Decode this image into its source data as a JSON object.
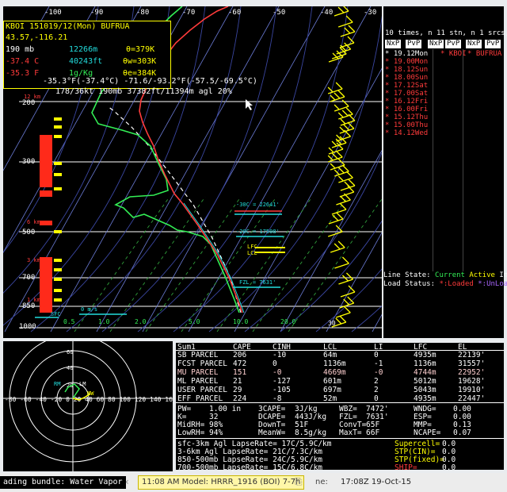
{
  "app": {
    "station_header": "KBOI 151019/12(Mon) BUFRUA",
    "latlon": "43.57,-116.21"
  },
  "readout": {
    "pressure": "190 mb",
    "height": "12266m",
    "theta": "θ=379K",
    "temp_c": "-37.4 C",
    "height_ft": "40243ft",
    "theta_w": "θw=303K",
    "dewpt_f": "-35.3 F",
    "mixing": "1g/Kg",
    "theta_e": "θe=384K",
    "line1": "-35.3°F(-37.4°C) -71.6/-93.2°F(-57.5/-69.5°C)",
    "line2": "178/36kt  190mb  37382ft/11394m agl  20%"
  },
  "temp_axis": [
    "-100",
    "-90",
    "-80",
    "-70",
    "-60",
    "-50",
    "-40",
    "-30"
  ],
  "pressure_axis": [
    "200",
    "300",
    "500",
    "700",
    "850",
    "1000"
  ],
  "km_labels": [
    "12 km",
    "6 km",
    "3 km",
    "1 km"
  ],
  "bottom_axis": [
    "0.5",
    "1.0",
    "2.0",
    "5.0",
    "10.0",
    "20.0",
    "30"
  ],
  "skewt_labels": {
    "minus30": "-30C = 22641'",
    "minus20": "-20C = 17508'",
    "lfc": "LFC",
    "lcl": "LCL",
    "fzl": "FZL = 7631'",
    "sfc": "SFC",
    "scale": "0 m/s"
  },
  "profile_list": {
    "header": "10 times, n 11 stn, n 1 srcs, n 1",
    "buttons": [
      "NxP",
      "PvP",
      "NxP",
      "PvP",
      "NxP",
      "PvP"
    ],
    "times": [
      "19.12Mon",
      "19.00Mon",
      "18.12Sun",
      "18.00Sun",
      "17.12Sat",
      "17.00Sat",
      "16.12Fri",
      "16.00Fri",
      "15.12Thu",
      "15.00Thu",
      "14.12Wed"
    ],
    "station": "KBOI",
    "source": "BUFRUA",
    "line_state_label": "Line State:",
    "line_state_current": "Current",
    "line_state_active": "Active",
    "line_state_inactive": "InActiv",
    "load_status_label": "Load Status:",
    "load_status_loaded": "*:Loaded",
    "load_status_unloaded": "*:UnLoa"
  },
  "hodo": {
    "rings": [
      "20",
      "40",
      "60",
      "80"
    ],
    "axis": "-80 -60 -40 -20 0 20 40 60 80 100 120 140 160",
    "lm": "LM",
    "mw": "MW",
    "rm": "RM"
  },
  "parcel_table": {
    "headers": [
      "Sum1",
      "CAPE",
      "CINH",
      "LCL",
      "LI",
      "LFC",
      "EL"
    ],
    "rows": [
      [
        "SB PARCEL",
        "206",
        "-10",
        "64m",
        "0",
        "4935m",
        "22139'"
      ],
      [
        "FCST PARCEL",
        "472",
        "0",
        "1136m",
        "-1",
        "1136m",
        "31557'"
      ],
      [
        "MU PARCEL",
        "151",
        "-0",
        "4669m",
        "-0",
        "4744m",
        "22952'"
      ],
      [
        "ML PARCEL",
        "21",
        "-127",
        "601m",
        "2",
        "5012m",
        "19628'"
      ],
      [
        "USER PARCEL",
        "29",
        "-105",
        "697m",
        "2",
        "5043m",
        "19910'"
      ],
      [
        "EFF PARCEL",
        "224",
        "-8",
        "52m",
        "0",
        "4935m",
        "22447'"
      ]
    ],
    "indices": [
      [
        "PW=",
        "1.00 in",
        "3CAPE=",
        "3J/kg",
        "WBZ=",
        "7472'",
        "WNDG=",
        "0.00"
      ],
      [
        "K=",
        "32",
        "DCAPE=",
        "443J/kg",
        "FZL=",
        "7631'",
        "ESP=",
        "0.00"
      ],
      [
        "MidRH=",
        "98%",
        "DownT=",
        "51F",
        "ConvT=",
        "65F",
        "MMP=",
        "0.13"
      ],
      [
        "LowRH=",
        "94%",
        "MeanW=",
        "8.5g/kg",
        "MaxT=",
        "66F",
        "NCAPE=",
        "0.07"
      ]
    ],
    "lapse": [
      "sfc-3km Agl LapseRate= 17C/5.9C/km",
      "3-6km Agl LapseRate= 21C/7.3C/km",
      "850-500mb LapseRate= 24C/5.9C/km",
      "700-500mb LapseRate= 15C/6.8C/km"
    ],
    "severe": [
      [
        "Supercell=",
        "0.0"
      ],
      [
        "STP(CIN)=",
        "0.0"
      ],
      [
        "STP(fixed)=",
        "0.0"
      ],
      [
        "SHIP=",
        "0.0"
      ]
    ]
  },
  "taskbar": {
    "loading": "ading bundle: Water Vapor",
    "model": "11:08 AM Model: HRRR_1916 (BOI) 7-7h",
    "time_label": "ne:",
    "time": "17:08Z 19-Oct-15"
  },
  "colors": {
    "temp": "#ff3b3b",
    "dewpt": "#33ee55",
    "wind": "#ffff00",
    "cyan": "#22dddd"
  }
}
